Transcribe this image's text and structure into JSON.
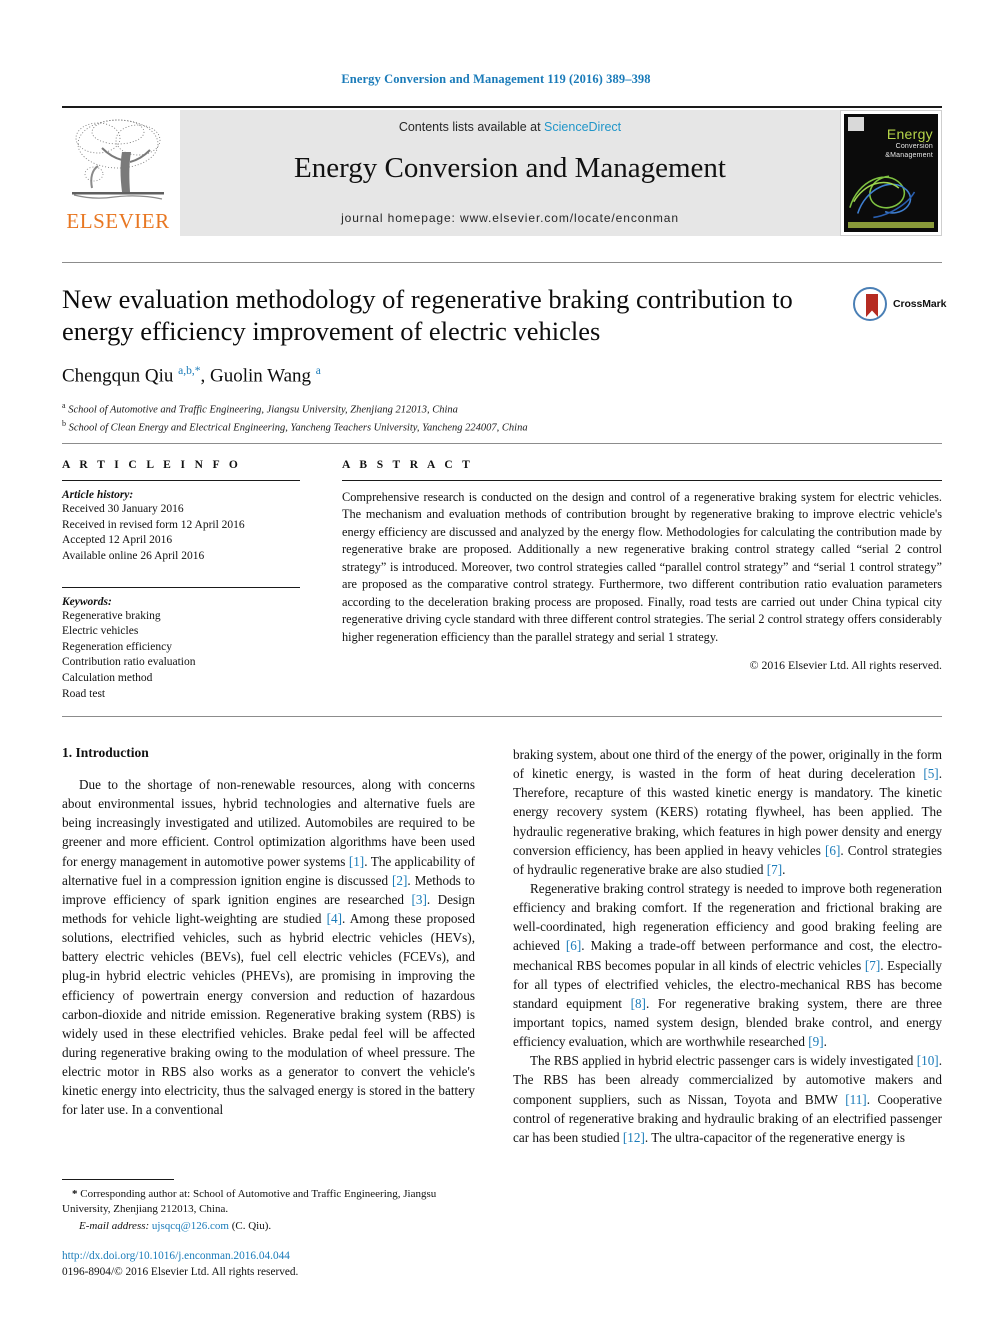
{
  "running_head": "Energy Conversion and Management 119 (2016) 389–398",
  "banner": {
    "publisher": "ELSEVIER",
    "contents_prefix": "Contents lists available at ",
    "contents_link": "ScienceDirect",
    "journal_title": "Energy Conversion and Management",
    "homepage": "journal homepage: www.elsevier.com/locate/enconman",
    "cover": {
      "title": "Energy",
      "sub1": "Conversion",
      "sub2": "&Management"
    }
  },
  "crossmark": {
    "label": "CrossMark"
  },
  "article": {
    "title": "New evaluation methodology of regenerative braking contribution to energy efficiency improvement of electric vehicles",
    "authors_html": "Chengqun Qiu <sup>a,b,*</sup>, Guolin Wang <sup>a</sup>",
    "affiliation_a": "School of Automotive and Traffic Engineering, Jiangsu University, Zhenjiang 212013, China",
    "affiliation_b": "School of Clean Energy and Electrical Engineering, Yancheng Teachers University, Yancheng 224007, China"
  },
  "info": {
    "heading": "A R T I C L E   I N F O",
    "history_label": "Article history:",
    "history": [
      "Received 30 January 2016",
      "Received in revised form 12 April 2016",
      "Accepted 12 April 2016",
      "Available online 26 April 2016"
    ],
    "keywords_label": "Keywords:",
    "keywords": [
      "Regenerative braking",
      "Electric vehicles",
      "Regeneration efficiency",
      "Contribution ratio evaluation",
      "Calculation method",
      "Road test"
    ]
  },
  "abstract": {
    "heading": "A B S T R A C T",
    "text": "Comprehensive research is conducted on the design and control of a regenerative braking system for electric vehicles. The mechanism and evaluation methods of contribution brought by regenerative braking to improve electric vehicle's energy efficiency are discussed and analyzed by the energy flow. Methodologies for calculating the contribution made by regenerative brake are proposed. Additionally a new regenerative braking control strategy called “serial 2 control strategy” is introduced. Moreover, two control strategies called “parallel control strategy” and “serial 1 control strategy” are proposed as the comparative control strategy. Furthermore, two different contribution ratio evaluation parameters according to the deceleration braking process are proposed. Finally, road tests are carried out under China typical city regenerative driving cycle standard with three different control strategies. The serial 2 control strategy offers considerably higher regeneration efficiency than the parallel strategy and serial 1 strategy.",
    "copyright": "© 2016 Elsevier Ltd. All rights reserved."
  },
  "body": {
    "section_heading": "1. Introduction",
    "left_paragraph_1_html": "Due to the shortage of non-renewable resources, along with concerns about environmental issues, hybrid technologies and alternative fuels are being increasingly investigated and utilized. Automobiles are required to be greener and more efficient. Control optimization algorithms have been used for energy management in automotive power systems <span class=\"ref\">[1]</span>. The applicability of alternative fuel in a compression ignition engine is discussed <span class=\"ref\">[2]</span>. Methods to improve efficiency of spark ignition engines are researched <span class=\"ref\">[3]</span>. Design methods for vehicle light-weighting are studied <span class=\"ref\">[4]</span>. Among these proposed solutions, electrified vehicles, such as hybrid electric vehicles (HEVs), battery electric vehicles (BEVs), fuel cell electric vehicles (FCEVs), and plug-in hybrid electric vehicles (PHEVs), are promising in improving the efficiency of powertrain energy conversion and reduction of hazardous carbon-dioxide and nitride emission. Regenerative braking system (RBS) is widely used in these electrified vehicles. Brake pedal feel will be affected during regenerative braking owing to the modulation of wheel pressure. The electric motor in RBS also works as a generator to convert the vehicle's kinetic energy into electricity, thus the salvaged energy is stored in the battery for later use. In a conventional",
    "right_paragraph_1_html": "braking system, about one third of the energy of the power, originally in the form of kinetic energy, is wasted in the form of heat during deceleration <span class=\"ref\">[5]</span>. Therefore, recapture of this wasted kinetic energy is mandatory. The kinetic energy recovery system (KERS) rotating flywheel, has been applied. The hydraulic regenerative braking, which features in high power density and energy conversion efficiency, has been applied in heavy vehicles <span class=\"ref\">[6]</span>. Control strategies of hydraulic regenerative brake are also studied <span class=\"ref\">[7]</span>.",
    "right_paragraph_2_html": "Regenerative braking control strategy is needed to improve both regeneration efficiency and braking comfort. If the regeneration and frictional braking are well-coordinated, high regeneration efficiency and good braking feeling are achieved <span class=\"ref\">[6]</span>. Making a trade-off between performance and cost, the electro-mechanical RBS becomes popular in all kinds of electric vehicles <span class=\"ref\">[7]</span>. Especially for all types of electrified vehicles, the electro-mechanical RBS has become standard equipment <span class=\"ref\">[8]</span>. For regenerative braking system, there are three important topics, named system design, blended brake control, and energy efficiency evaluation, which are worthwhile researched <span class=\"ref\">[9]</span>.",
    "right_paragraph_3_html": "The RBS applied in hybrid electric passenger cars is widely investigated <span class=\"ref\">[10]</span>. The RBS has been already commercialized by automotive makers and component suppliers, such as Nissan, Toyota and BMW <span class=\"ref\">[11]</span>. Cooperative control of regenerative braking and hydraulic braking of an electrified passenger car has been studied <span class=\"ref\">[12]</span>. The ultra-capacitor of the regenerative energy is"
  },
  "footnote": {
    "corresponding_html": "<b>*</b> Corresponding author at: School of Automotive and Traffic Engineering, Jiangsu University, Zhenjiang 212013, China.",
    "email_label": "E-mail address:",
    "email": "ujsqcq@126.com",
    "email_suffix": "(C. Qiu)."
  },
  "imprint": {
    "doi": "http://dx.doi.org/10.1016/j.enconman.2016.04.044",
    "issn_line": "0196-8904/© 2016 Elsevier Ltd. All rights reserved."
  },
  "colors": {
    "link_blue": "#1a7bb9",
    "sciencedirect_blue": "#2196c9",
    "elsevier_orange": "#e87722",
    "banner_grey": "#e6e6e6"
  }
}
